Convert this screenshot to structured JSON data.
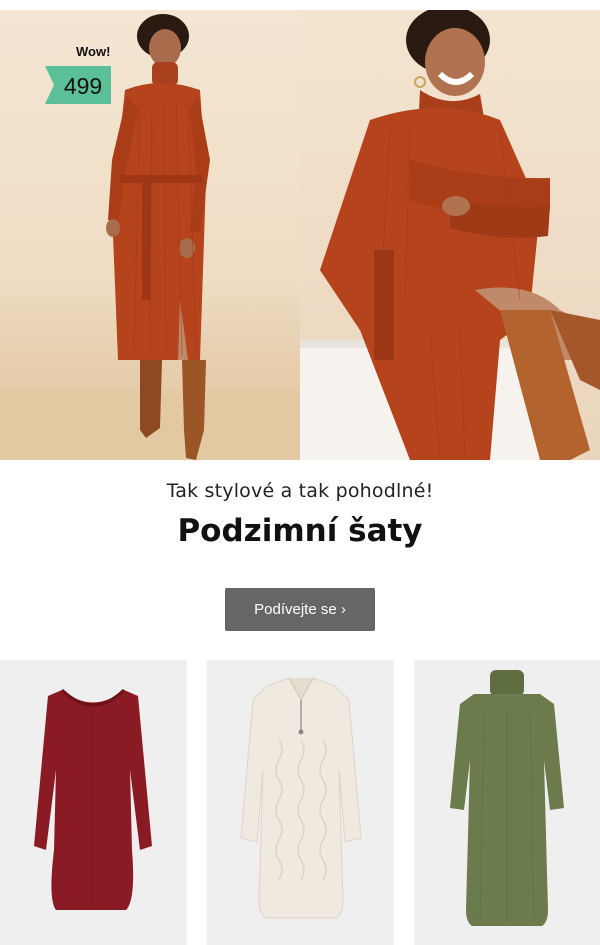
{
  "hero": {
    "badge_text": "Wow!",
    "price": "499",
    "badge_color": "#5bbf97",
    "dress_color": "#b5431c",
    "left_image_icon": "woman-standing-rust-dress-photo",
    "right_image_icon": "woman-sitting-rust-dress-photo"
  },
  "tagline": "Tak stylové a tak pohodlné!",
  "headline": "Podzimní šaty",
  "cta": {
    "label": "Podívejte se ›",
    "color": "#666666"
  },
  "products": [
    {
      "icon": "burgundy-knit-dress-photo",
      "color": "#8a1a24"
    },
    {
      "icon": "cream-cable-knit-dress-photo",
      "color": "#efe9df"
    },
    {
      "icon": "olive-turtleneck-dress-photo",
      "color": "#6b7b4b"
    }
  ]
}
